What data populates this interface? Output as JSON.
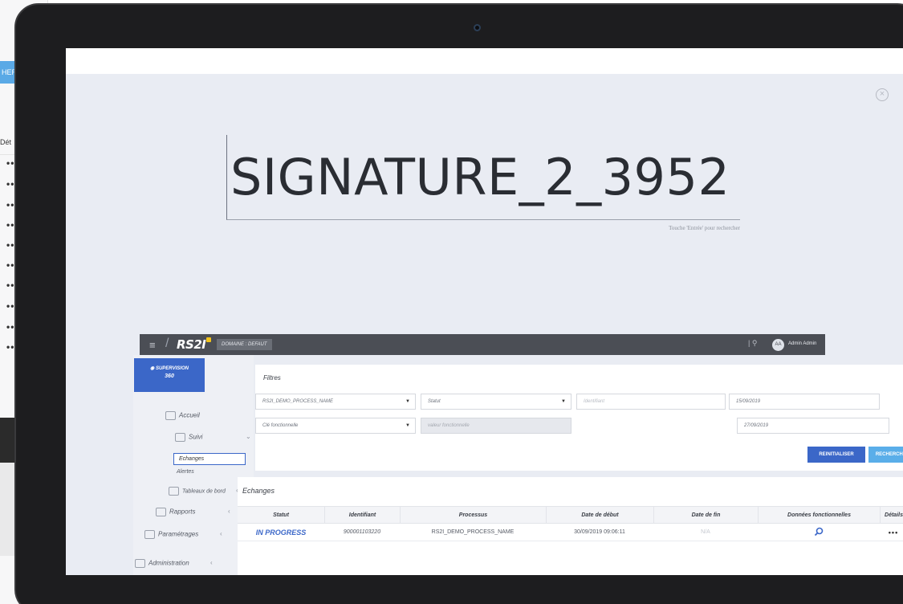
{
  "background": {
    "button_label": "HERC",
    "column_header": "Dét",
    "row_marker": "••"
  },
  "overlay": {
    "query": "SIGNATURE_2_3952",
    "hint": "Touche 'Entrée' pour rechercher",
    "close_icon": "close-circle-icon"
  },
  "app": {
    "logo": "RS2I",
    "domain_badge": "DOMAINE : DEFAUT",
    "user": {
      "initials": "AA",
      "name": "Admin Admin"
    },
    "sidebar": {
      "supervision_line1": "SUPERVISION",
      "supervision_line2": "360",
      "accueil": "Accueil",
      "suivi": "Suivi",
      "echanges": "Echanges",
      "alertes": "Alertes",
      "tableaux": "Tableaux de bord",
      "rapports": "Rapports",
      "parametrages": "Paramétrages",
      "administration": "Administration"
    },
    "filters": {
      "title": "Filtres",
      "process": "RS2I_DEMO_PROCESS_NAME",
      "statut": "Statut",
      "identifiant": "Identifiant",
      "date_start": "15/09/2019",
      "cle": "Clé fonctionnelle",
      "valeur": "valeur fonctionnelle",
      "date_end": "27/09/2019",
      "reset_label": "REINITIALISER",
      "search_label": "RECHERCHER"
    },
    "echanges": {
      "title": "Echanges",
      "columns": [
        "Statut",
        "Identifiant",
        "Processus",
        "Date de début",
        "Date de fin",
        "Données fonctionnelles",
        "Détails"
      ],
      "rows": [
        {
          "statut": "IN PROGRESS",
          "identifiant": "900001103220",
          "processus": "RS2I_DEMO_PROCESS_NAME",
          "debut": "30/09/2019 09:06:11",
          "fin": "N/A",
          "details": "•••"
        }
      ]
    }
  }
}
